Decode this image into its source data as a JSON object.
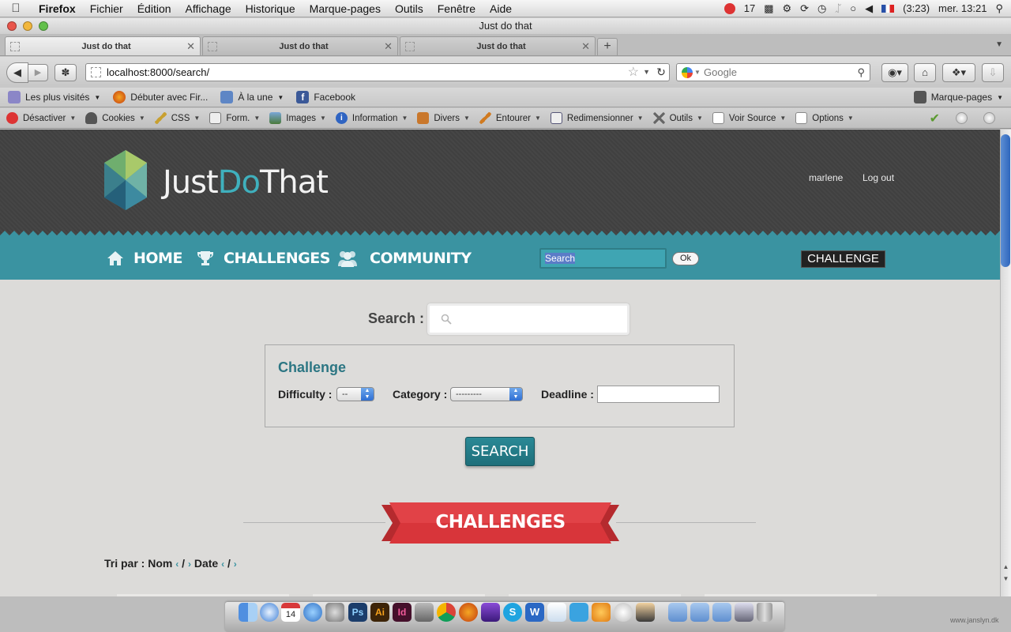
{
  "menubar": {
    "app": "Firefox",
    "items": [
      "Fichier",
      "Édition",
      "Affichage",
      "Historique",
      "Marque-pages",
      "Outils",
      "Fenêtre",
      "Aide"
    ],
    "status_count": "17",
    "battery": "(3:23)",
    "clock": "mer. 13:21"
  },
  "window": {
    "title": "Just do that"
  },
  "tabs": [
    {
      "label": "Just do that",
      "active": true
    },
    {
      "label": "Just do that",
      "active": false
    },
    {
      "label": "Just do that",
      "active": false
    }
  ],
  "nav": {
    "url": "localhost:8000/search/",
    "search_placeholder": "Google"
  },
  "bookmarks": {
    "items": [
      "Les plus visités",
      "Débuter avec Fir...",
      "À la une",
      "Facebook"
    ],
    "right": "Marque-pages"
  },
  "devbar": {
    "items": [
      "Désactiver",
      "Cookies",
      "CSS",
      "Form.",
      "Images",
      "Information",
      "Divers",
      "Entourer",
      "Redimensionner",
      "Outils",
      "Voir Source",
      "Options"
    ]
  },
  "site": {
    "logo_just": "Just",
    "logo_do": "Do",
    "logo_that": "That",
    "user": "marlene",
    "logout": "Log out",
    "nav": [
      "HOME",
      "CHALLENGES",
      "COMMUNITY"
    ],
    "nav_search": "Search",
    "nav_ok": "Ok",
    "nav_challenge": "CHALLENGE"
  },
  "search": {
    "label": "Search :",
    "input_value": "",
    "filter_title": "Challenge",
    "difficulty_label": "Difficulty :",
    "difficulty_value": "--",
    "category_label": "Category :",
    "category_value": "---------",
    "deadline_label": "Deadline :",
    "deadline_value": "",
    "button": "SEARCH"
  },
  "results": {
    "heading": "CHALLENGES",
    "sort_label": "Tri par :",
    "sort_name": "Nom",
    "sort_date": "Date"
  },
  "credit": "www.janslyn.dk",
  "colors": {
    "header_bg": "#404040",
    "teal": "#3a93a1",
    "ribbon_red": "#d8353a",
    "page_bg": "#dcdbd9"
  }
}
